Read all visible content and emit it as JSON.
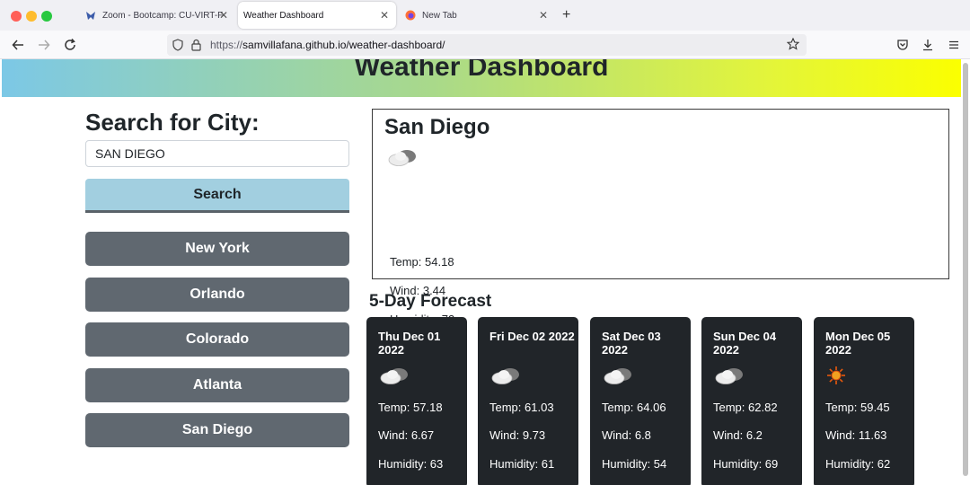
{
  "browser": {
    "tabs": [
      {
        "title": "Zoom - Bootcamp: CU-VIRT-FSF",
        "active": false,
        "icon": "zoom-icon"
      },
      {
        "title": "Weather Dashboard",
        "active": true,
        "icon": ""
      },
      {
        "title": "New Tab",
        "active": false,
        "icon": "firefox-icon"
      }
    ],
    "url_scheme": "https://",
    "url_rest": "samvillafana.github.io/weather-dashboard/"
  },
  "page": {
    "title": "Weather Dashboard",
    "search_heading": "Search for City:",
    "search_value": "SAN DIEGO",
    "search_button": "Search",
    "history": [
      "New York",
      "Orlando",
      "Colorado",
      "Atlanta",
      "San Diego"
    ],
    "current": {
      "city": "San Diego",
      "icon": "cloud-icon",
      "temp": "Temp: 54.18",
      "wind": "Wind: 3.44",
      "humidity": "Humidity: 73"
    },
    "forecast_heading": "5-Day Forecast",
    "forecast": [
      {
        "date": "Thu Dec 01 2022",
        "icon": "cloud-icon",
        "temp": "Temp: 57.18",
        "wind": "Wind: 6.67",
        "humidity": "Humidity: 63"
      },
      {
        "date": "Fri Dec 02 2022",
        "icon": "cloud-icon",
        "temp": "Temp: 61.03",
        "wind": "Wind: 9.73",
        "humidity": "Humidity: 61"
      },
      {
        "date": "Sat Dec 03 2022",
        "icon": "cloud-icon",
        "temp": "Temp: 64.06",
        "wind": "Wind: 6.8",
        "humidity": "Humidity: 54"
      },
      {
        "date": "Sun Dec 04 2022",
        "icon": "cloud-icon",
        "temp": "Temp: 62.82",
        "wind": "Wind: 6.2",
        "humidity": "Humidity: 69"
      },
      {
        "date": "Mon Dec 05 2022",
        "icon": "sun-icon",
        "temp": "Temp: 59.45",
        "wind": "Wind: 11.63",
        "humidity": "Humidity: 62"
      }
    ]
  },
  "colors": {
    "accent_blue": "#a2cfe0",
    "history_button": "#606870",
    "card_background": "#212529",
    "gradient_start": "#7cc8e6",
    "gradient_end": "#fbff00"
  }
}
